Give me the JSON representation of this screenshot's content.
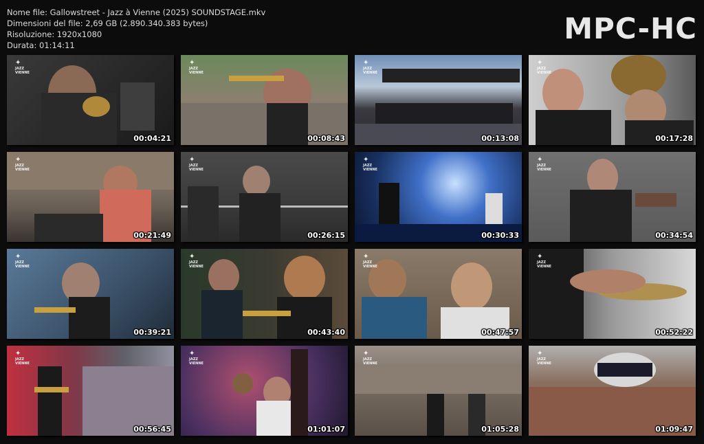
{
  "info": {
    "filename": "Nome file: Gallowstreet - Jazz à Vienne (2025) SOUNDSTAGE.mkv",
    "filesize": "Dimensioni del file: 2,69 GB (2.890.340.383 bytes)",
    "resolution": "Risoluzione: 1920x1080",
    "duration": "Durata: 01:14:11"
  },
  "brand": "MPC-HC",
  "thumbnails": [
    {
      "time": "00:04:21",
      "scene": "trombone-player-closeup"
    },
    {
      "time": "00:08:43",
      "scene": "trumpet-player-outdoor-crowd"
    },
    {
      "time": "00:13:08",
      "scene": "wide-stage-view"
    },
    {
      "time": "00:17:28",
      "scene": "trumpet-and-sousaphone"
    },
    {
      "time": "00:21:49",
      "scene": "drummer-arena-crowd"
    },
    {
      "time": "00:26:15",
      "scene": "vocalists-on-stage"
    },
    {
      "time": "00:30:33",
      "scene": "blue-lit-stage"
    },
    {
      "time": "00:34:54",
      "scene": "vocalist-with-microphone"
    },
    {
      "time": "00:39:21",
      "scene": "trumpet-player-blue-light"
    },
    {
      "time": "00:43:40",
      "scene": "trumpet-section"
    },
    {
      "time": "00:47:57",
      "scene": "audience-closeup"
    },
    {
      "time": "00:52:22",
      "scene": "drummer-cymbals"
    },
    {
      "time": "00:56:45",
      "scene": "saxophone-red-light"
    },
    {
      "time": "01:01:07",
      "scene": "drummer-double-bass"
    },
    {
      "time": "01:05:28",
      "scene": "crowd-from-stage"
    },
    {
      "time": "01:09:47",
      "scene": "aerial-arena-view"
    }
  ],
  "logo": {
    "mark": "✦",
    "line1": "JAZZ",
    "line2": "VIENNE"
  },
  "colors": {
    "background": "#0c0c0c",
    "text": "#dcdcdc",
    "brand": "#e8e8e8"
  }
}
